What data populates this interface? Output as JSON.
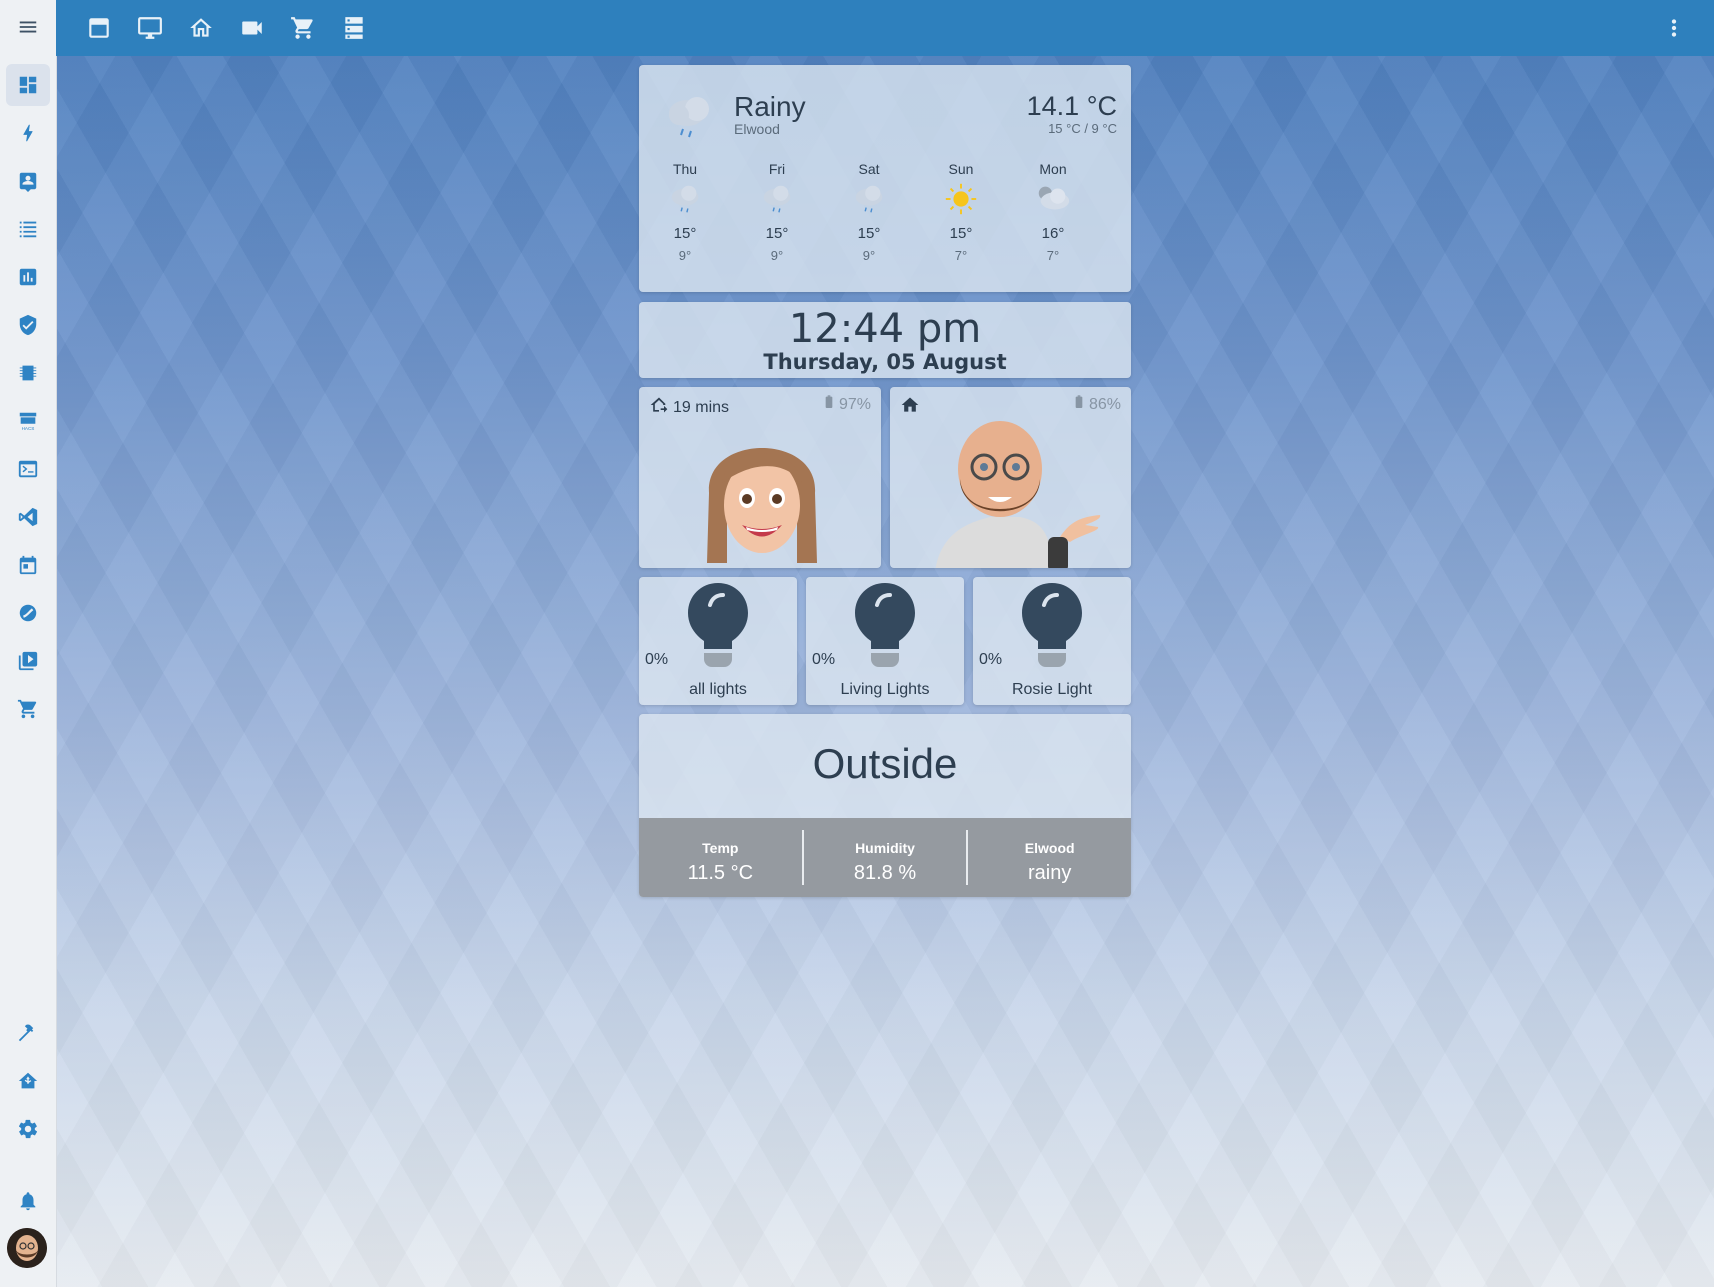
{
  "colors": {
    "accent": "#2e80bd",
    "sidebar_icon": "#2e83c4",
    "card_text": "#2d3e50"
  },
  "sidebar": {
    "items": [
      {
        "name": "menu-icon"
      },
      {
        "name": "overview-icon"
      },
      {
        "name": "energy-icon"
      },
      {
        "name": "map-icon"
      },
      {
        "name": "logbook-icon"
      },
      {
        "name": "history-icon"
      },
      {
        "name": "security-icon"
      },
      {
        "name": "esphome-icon"
      },
      {
        "name": "hacs-icon"
      },
      {
        "name": "terminal-icon"
      },
      {
        "name": "vscode-icon"
      },
      {
        "name": "calendar-icon"
      },
      {
        "name": "node-red-icon"
      },
      {
        "name": "media-icon"
      },
      {
        "name": "shopping-cart-icon"
      },
      {
        "name": "developer-tools-icon"
      },
      {
        "name": "supervisor-icon"
      },
      {
        "name": "settings-icon"
      },
      {
        "name": "notifications-icon"
      },
      {
        "name": "user-avatar"
      }
    ]
  },
  "topbar": {
    "tabs": [
      {
        "name": "tab-dashboard-icon"
      },
      {
        "name": "tab-monitor-icon"
      },
      {
        "name": "tab-home-icon"
      },
      {
        "name": "tab-camera-icon"
      },
      {
        "name": "tab-cart-icon"
      },
      {
        "name": "tab-server-icon"
      }
    ],
    "more": "more-vertical-icon"
  },
  "weather": {
    "condition": "Rainy",
    "location": "Elwood",
    "temperature": "14.1 °C",
    "range": "15 °C / 9 °C",
    "forecast": [
      {
        "day": "Thu",
        "icon": "rainy",
        "high": "15°",
        "low": "9°"
      },
      {
        "day": "Fri",
        "icon": "rainy",
        "high": "15°",
        "low": "9°"
      },
      {
        "day": "Sat",
        "icon": "rainy",
        "high": "15°",
        "low": "9°"
      },
      {
        "day": "Sun",
        "icon": "sunny",
        "high": "15°",
        "low": "7°"
      },
      {
        "day": "Mon",
        "icon": "cloudy",
        "high": "16°",
        "low": "7°"
      }
    ]
  },
  "clock": {
    "time": "12:44 pm",
    "date": "Thursday, 05 August"
  },
  "people": [
    {
      "status": "19 mins",
      "status_icon": "home-export-icon",
      "battery": "97%"
    },
    {
      "status": "",
      "status_icon": "home-icon",
      "battery": "86%"
    }
  ],
  "lights": [
    {
      "name": "all lights",
      "level": "0%"
    },
    {
      "name": "Living Lights",
      "level": "0%"
    },
    {
      "name": "Rosie Light",
      "level": "0%"
    }
  ],
  "outside": {
    "title": "Outside",
    "stats": [
      {
        "label": "Temp",
        "value": "11.5 °C"
      },
      {
        "label": "Humidity",
        "value": "81.8 %"
      },
      {
        "label": "Elwood",
        "value": "rainy"
      }
    ]
  }
}
